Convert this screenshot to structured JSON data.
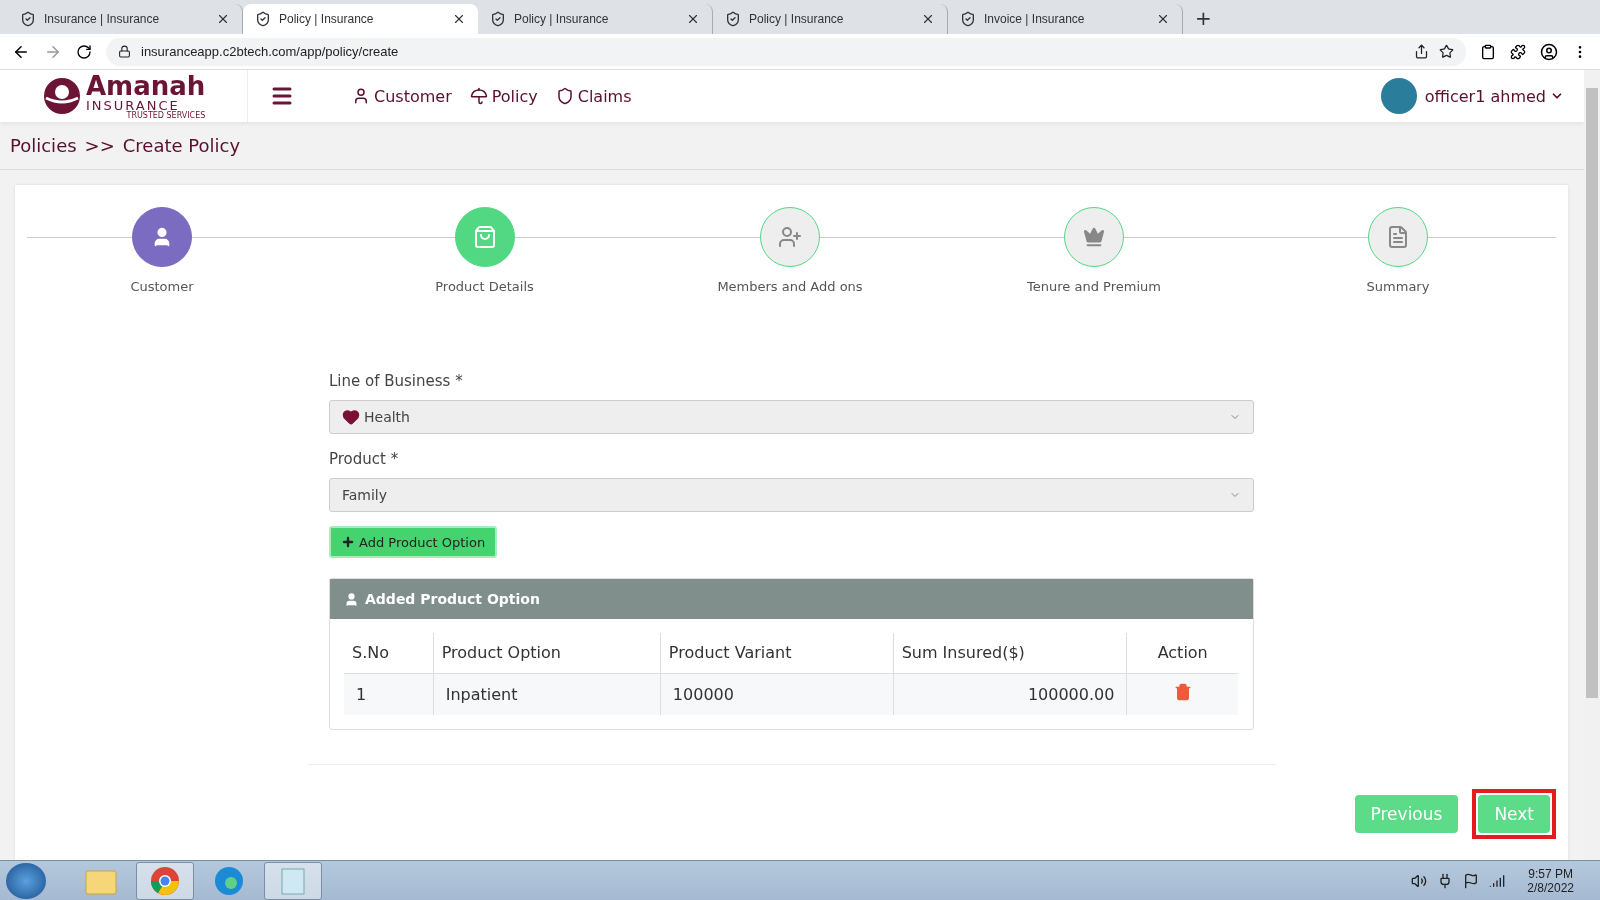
{
  "browser": {
    "tabs": [
      {
        "title": "Insurance | Insurance",
        "selected": false
      },
      {
        "title": "Policy | Insurance",
        "selected": true
      },
      {
        "title": "Policy | Insurance",
        "selected": false
      },
      {
        "title": "Policy | Insurance",
        "selected": false
      },
      {
        "title": "Invoice | Insurance",
        "selected": false
      }
    ],
    "new_tab": "+",
    "url": "insuranceapp.c2btech.com/app/policy/create"
  },
  "header": {
    "logo": {
      "name": "Amanah",
      "sub": "INSURANCE",
      "tagline": "TRUSTED SERVICES"
    },
    "nav": [
      {
        "label": "Customer",
        "kind": "user"
      },
      {
        "label": "Policy",
        "kind": "umbrella"
      },
      {
        "label": "Claims",
        "kind": "shield"
      }
    ],
    "user": "officer1 ahmed"
  },
  "breadcrumb": {
    "parent": "Policies",
    "separator": ">>",
    "current": "Create Policy"
  },
  "steps": [
    {
      "label": "Customer",
      "kind": "user",
      "completed": true,
      "selected": false
    },
    {
      "label": "Product Details",
      "kind": "bag",
      "completed": false,
      "selected": true
    },
    {
      "label": "Members and Add ons",
      "kind": "users",
      "completed": false,
      "selected": false
    },
    {
      "label": "Tenure and Premium",
      "kind": "crown",
      "completed": false,
      "selected": false
    },
    {
      "label": "Summary",
      "kind": "file",
      "completed": false,
      "selected": false
    }
  ],
  "form": {
    "line_of_business": {
      "label": "Line of Business *",
      "value": "Health"
    },
    "product": {
      "label": "Product *",
      "value": "Family"
    },
    "add_button": "Add Product Option"
  },
  "table": {
    "title": "Added Product Option",
    "columns": [
      "S.No",
      "Product Option",
      "Product Variant",
      "Sum Insured($)",
      "Action"
    ],
    "rows": [
      {
        "sno": "1",
        "option": "Inpatient",
        "variant": "100000",
        "sum": "100000.00"
      }
    ]
  },
  "actions": [
    {
      "label": "Previous",
      "highlighted": false
    },
    {
      "label": "Next",
      "highlighted": true
    }
  ],
  "taskbar": {
    "apps": [
      {
        "kind": "folder",
        "selected": false
      },
      {
        "kind": "chrome",
        "selected": true
      },
      {
        "kind": "edge",
        "selected": false
      },
      {
        "kind": "notepad",
        "selected": true
      }
    ],
    "time": "9:57 PM",
    "date": "2/8/2022"
  }
}
